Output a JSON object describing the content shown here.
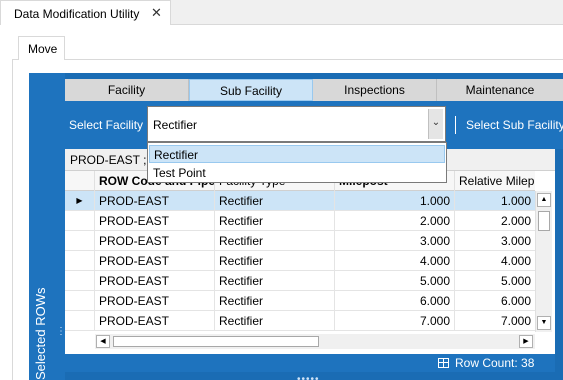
{
  "window": {
    "tab_title": "Data Modification Utility",
    "close_glyph": "✕"
  },
  "inner_tab": {
    "label": "Move"
  },
  "side_panel": {
    "title": "Selected ROWs",
    "grip_glyph": "⋮"
  },
  "facility_tabs": [
    "Facility",
    "Sub Facility",
    "Inspections",
    "Maintenance"
  ],
  "active_tab_index": 1,
  "selector": {
    "facility_label": "Select Facility",
    "facility_value": "Rectifier",
    "sub_facility_label": "Select Sub Facility",
    "dropdown_glyph": "⌄"
  },
  "dropdown": {
    "options": [
      "Rectifier",
      "Test Point"
    ],
    "highlighted_index": 0
  },
  "grid": {
    "group_header": "PROD-EAST ; E",
    "columns": [
      "ROW Code and Pipe",
      "Facility Type",
      "Milepost",
      "Relative Milep"
    ],
    "selected_row_index": 0,
    "row_indicator_glyph": "▶",
    "rows": [
      [
        "PROD-EAST",
        "Rectifier",
        "1.000",
        "1.000"
      ],
      [
        "PROD-EAST",
        "Rectifier",
        "2.000",
        "2.000"
      ],
      [
        "PROD-EAST",
        "Rectifier",
        "3.000",
        "3.000"
      ],
      [
        "PROD-EAST",
        "Rectifier",
        "4.000",
        "4.000"
      ],
      [
        "PROD-EAST",
        "Rectifier",
        "5.000",
        "5.000"
      ],
      [
        "PROD-EAST",
        "Rectifier",
        "6.000",
        "6.000"
      ],
      [
        "PROD-EAST",
        "Rectifier",
        "7.000",
        "7.000"
      ]
    ]
  },
  "status": {
    "row_count_label": "Row Count:",
    "row_count": "38"
  },
  "colors": {
    "accent_blue": "#1e73be",
    "selection": "#cce4f7"
  }
}
